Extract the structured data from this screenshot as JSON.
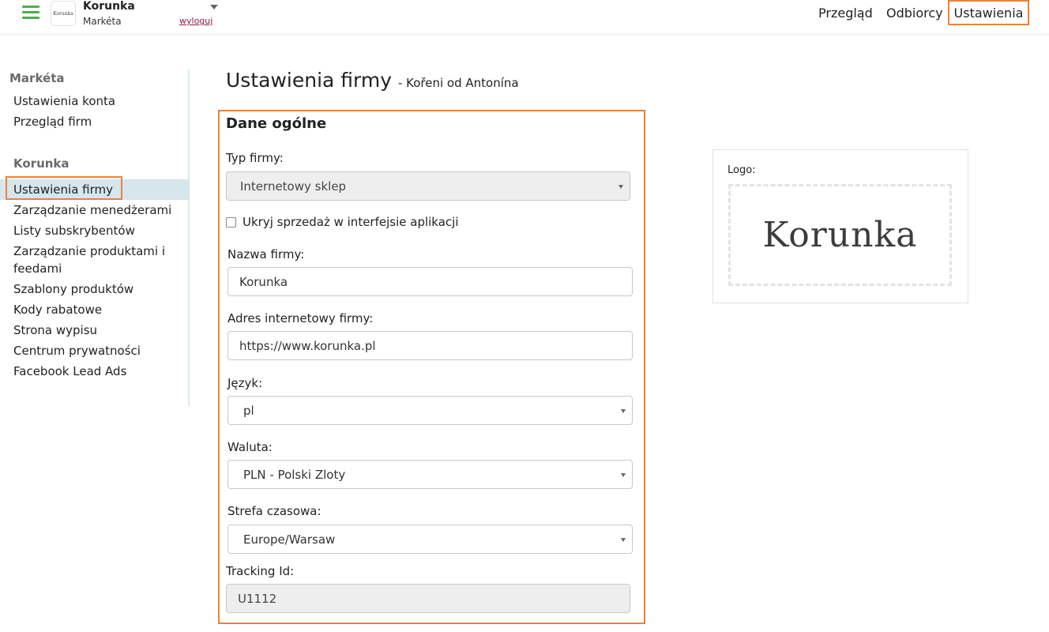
{
  "header": {
    "logo_text": "Korunka",
    "account_name": "Korunka",
    "account_user": "Markéta",
    "logout_label": "wyloguj",
    "nav": [
      {
        "label": "Przegląd"
      },
      {
        "label": "Odbiorcy"
      },
      {
        "label": "Ustawienia",
        "active": true
      }
    ]
  },
  "sidebar": {
    "user_heading": "Markéta",
    "user_items": [
      {
        "label": "Ustawienia konta"
      },
      {
        "label": "Przegląd firm"
      }
    ],
    "company_heading": "Korunka",
    "company_items": [
      {
        "label": "Ustawienia firmy",
        "active": true
      },
      {
        "label": "Zarządzanie menedżerami"
      },
      {
        "label": "Listy subskrybentów"
      },
      {
        "label": "Zarządzanie produktami i feedami"
      },
      {
        "label": "Szablony produktów"
      },
      {
        "label": "Kody rabatowe"
      },
      {
        "label": "Strona wypisu"
      },
      {
        "label": "Centrum prywatności"
      },
      {
        "label": "Facebook Lead Ads"
      }
    ]
  },
  "page": {
    "title": "Ustawienia firmy",
    "subtitle": "- Kořeni od Antonína"
  },
  "form": {
    "section_title": "Dane ogólne",
    "company_type": {
      "label": "Typ firmy:",
      "value": "Internetowy sklep"
    },
    "hide_sales": {
      "label": "Ukryj sprzedaż w interfejsie aplikacji",
      "checked": false
    },
    "company_name": {
      "label": "Nazwa firmy:",
      "value": "Korunka"
    },
    "company_url": {
      "label": "Adres internetowy firmy:",
      "value": "https://www.korunka.pl"
    },
    "language": {
      "label": "Język:",
      "value": "pl"
    },
    "currency": {
      "label": "Waluta:",
      "value": "PLN - Polski Zloty"
    },
    "timezone": {
      "label": "Strefa czasowa:",
      "value": "Europe/Warsaw"
    },
    "tracking_id": {
      "label": "Tracking Id:",
      "value": "U1112"
    }
  },
  "logo_panel": {
    "label": "Logo:",
    "logo_text": "Korunka"
  },
  "colors": {
    "accent_highlight": "#e8833a",
    "menu_green": "#4caf50",
    "active_item_bg": "#d6e6ec",
    "logout_link": "#8b1a4a"
  },
  "icons": {
    "menu": "hamburger-icon",
    "account_dropdown": "chevron-down-icon",
    "select_dropdown": "caret-down-icon"
  }
}
